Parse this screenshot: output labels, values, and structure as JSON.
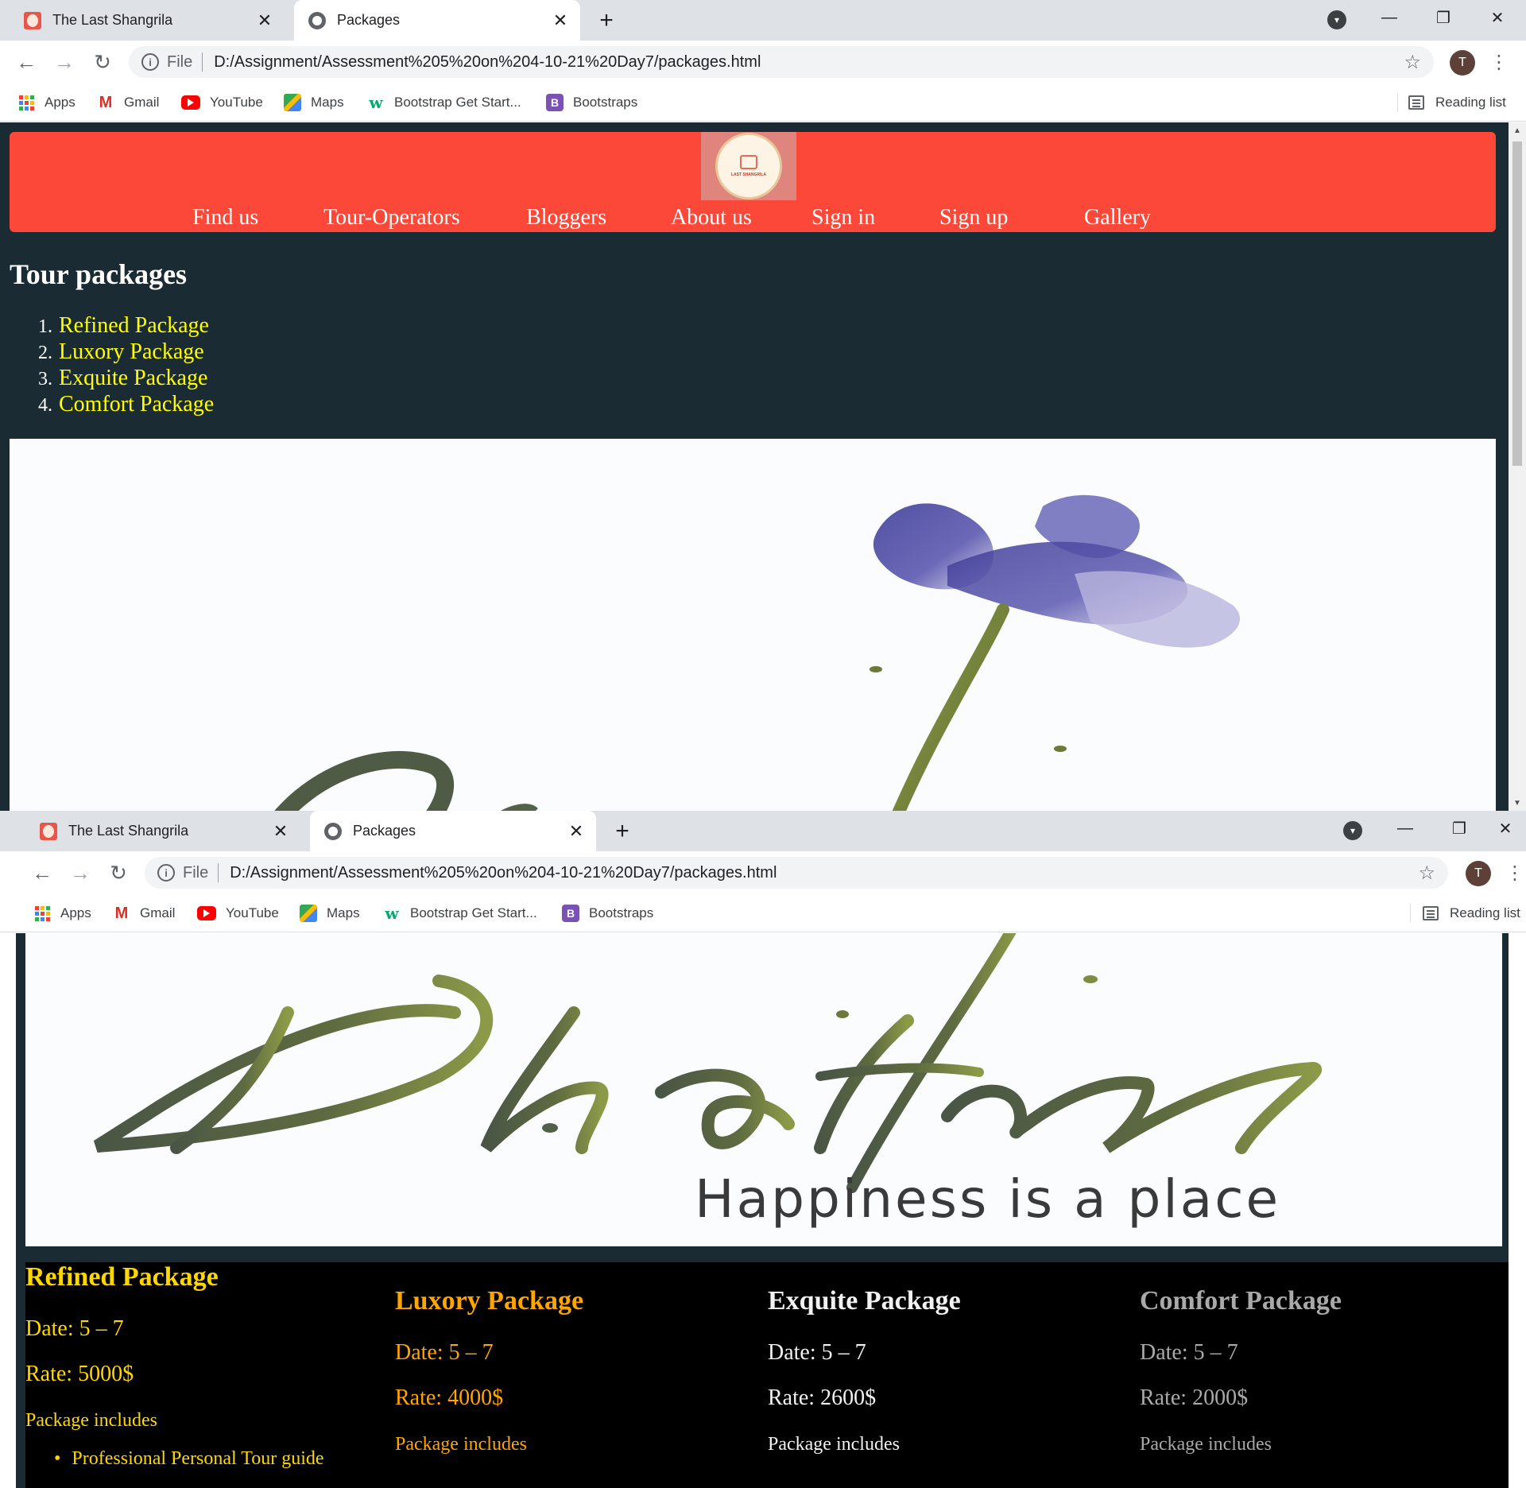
{
  "browser": {
    "tabs": [
      {
        "title": "The Last Shangrila",
        "active": false
      },
      {
        "title": "Packages",
        "active": true
      }
    ],
    "address": {
      "scheme": "File",
      "url": "D:/Assignment/Assessment%205%20on%204-10-21%20Day7/packages.html"
    },
    "profile_initial": "T",
    "bookmarks": [
      "Apps",
      "Gmail",
      "YouTube",
      "Maps",
      "Bootstrap Get Start...",
      "Bootstraps"
    ],
    "reading_list": "Reading list"
  },
  "page": {
    "nav": [
      "Find us",
      "Tour-Operators",
      "Bloggers",
      "About us",
      "Sign in",
      "Sign up",
      "Gallery"
    ],
    "logo_text": "LAST SHANGRILA",
    "heading": "Tour packages",
    "list_numbers": [
      "1.",
      "2.",
      "3.",
      "4."
    ],
    "packages_list": [
      "Refined Package",
      "Luxory Package",
      "Exquite Package",
      "Comfort Package"
    ],
    "banner": {
      "script_word": "Bhutan",
      "tagline": "Happiness is a place"
    },
    "package_details": [
      {
        "name": "Refined Package",
        "date": "Date: 5 – 7",
        "rate": "Rate: 5000$",
        "includes": "Package includes",
        "items": [
          "Professional Personal Tour guide"
        ],
        "color": "#ffd700"
      },
      {
        "name": "Luxory Package",
        "date": "Date: 5 – 7",
        "rate": "Rate: 4000$",
        "includes": "Package includes",
        "color": "#ffa500"
      },
      {
        "name": "Exquite Package",
        "date": "Date: 5 – 7",
        "rate": "Rate: 2600$",
        "includes": "Package includes",
        "color": "#f2f2f2"
      },
      {
        "name": "Comfort Package",
        "date": "Date: 5 – 7",
        "rate": "Rate: 2000$",
        "includes": "Package includes",
        "color": "#a9a9a9"
      }
    ]
  },
  "colors": {
    "header": "#fc4838",
    "page_bg": "#1b2b33",
    "link": "#ffff00",
    "chrome_tabstrip": "#dee1e6"
  }
}
